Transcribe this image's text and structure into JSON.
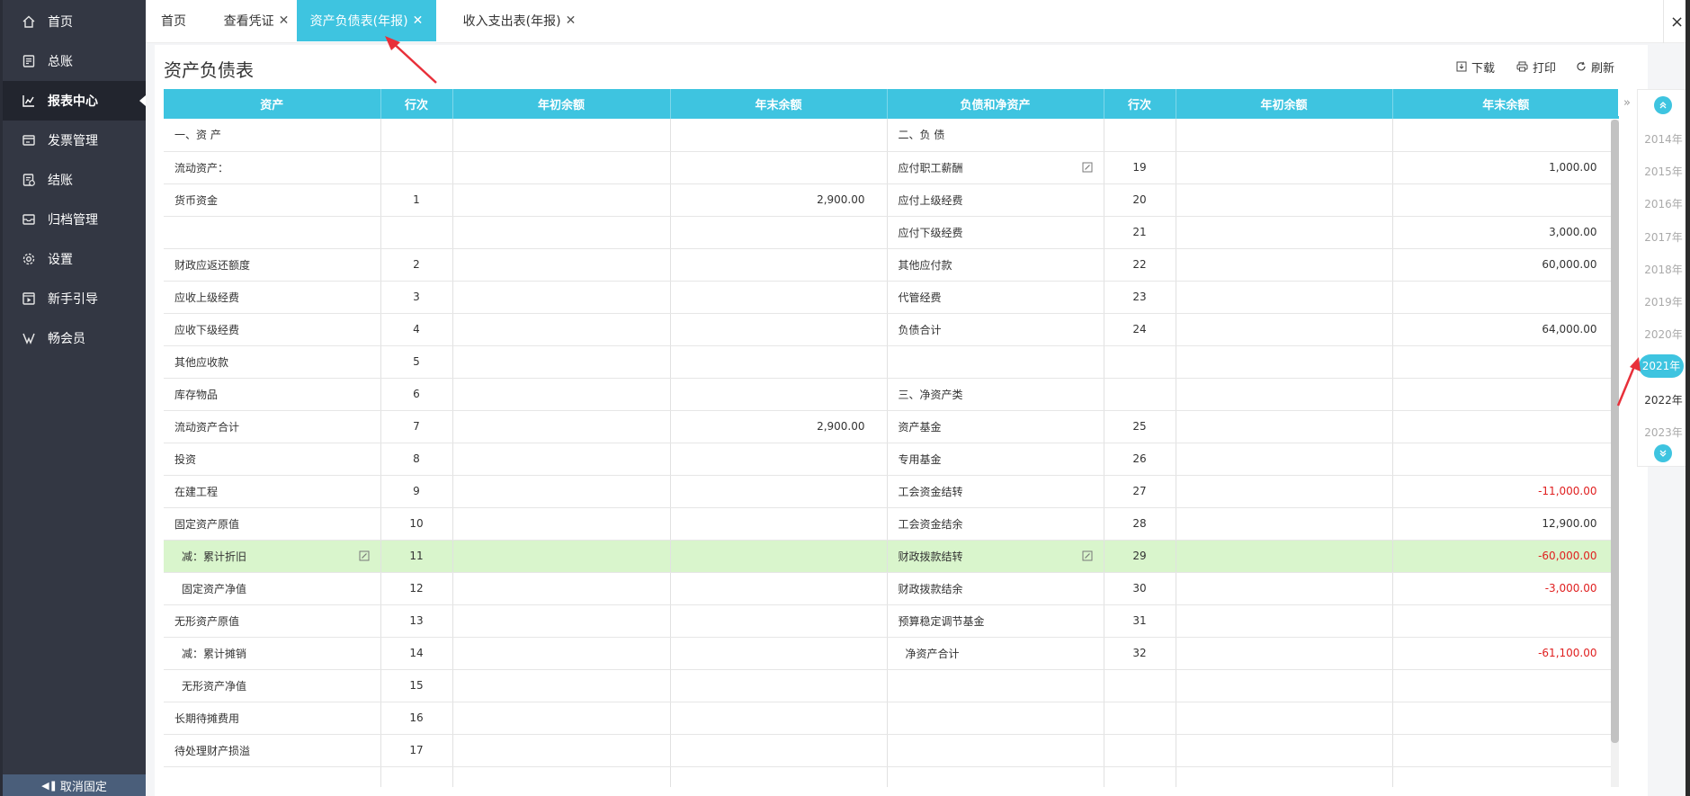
{
  "sidebar": {
    "items": [
      {
        "label": "首页",
        "icon": "home-icon"
      },
      {
        "label": "总账",
        "icon": "ledger-icon"
      },
      {
        "label": "报表中心",
        "icon": "chart-icon",
        "active": true
      },
      {
        "label": "发票管理",
        "icon": "invoice-icon"
      },
      {
        "label": "结账",
        "icon": "checkout-icon"
      },
      {
        "label": "归档管理",
        "icon": "archive-icon"
      },
      {
        "label": "设置",
        "icon": "gear-icon"
      },
      {
        "label": "新手引导",
        "icon": "guide-icon"
      },
      {
        "label": "畅会员",
        "icon": "vip-icon"
      }
    ],
    "unpin_label": "取消固定"
  },
  "tabs": [
    {
      "label": "首页",
      "closable": false
    },
    {
      "label": "查看凭证",
      "closable": true
    },
    {
      "label": "资产负债表(年报)",
      "closable": true,
      "active": true
    },
    {
      "label": "收入支出表(年报)",
      "closable": true
    }
  ],
  "window_close": "×",
  "page": {
    "title": "资产负债表",
    "toolbar": {
      "download": "下载",
      "print": "打印",
      "refresh": "刷新"
    }
  },
  "table": {
    "headers": [
      "资产",
      "行次",
      "年初余额",
      "年末余额",
      "负债和净资产",
      "行次",
      "年初余额",
      "年末余额"
    ],
    "rows": [
      {
        "a": "一、资 产",
        "al": "",
        "ab": "",
        "ae": "",
        "l": "二、负 债",
        "ll": "",
        "lb": "",
        "le": ""
      },
      {
        "a": "流动资产：",
        "al": "",
        "ab": "",
        "ae": "",
        "l": "应付职工薪酬",
        "ll": "19",
        "lb": "",
        "le": "1,000.00",
        "l_edit": true
      },
      {
        "a": "货币资金",
        "al": "1",
        "ab": "",
        "ae": "2,900.00",
        "l": "应付上级经费",
        "ll": "20",
        "lb": "",
        "le": ""
      },
      {
        "a": "",
        "al": "",
        "ab": "",
        "ae": "",
        "l": "应付下级经费",
        "ll": "21",
        "lb": "",
        "le": "3,000.00"
      },
      {
        "a": "财政应返还额度",
        "al": "2",
        "ab": "",
        "ae": "",
        "l": "其他应付款",
        "ll": "22",
        "lb": "",
        "le": "60,000.00"
      },
      {
        "a": "应收上级经费",
        "al": "3",
        "ab": "",
        "ae": "",
        "l": "代管经费",
        "ll": "23",
        "lb": "",
        "le": ""
      },
      {
        "a": "应收下级经费",
        "al": "4",
        "ab": "",
        "ae": "",
        "l": "负债合计",
        "ll": "24",
        "lb": "",
        "le": "64,000.00"
      },
      {
        "a": "其他应收款",
        "al": "5",
        "ab": "",
        "ae": "",
        "l": "",
        "ll": "",
        "lb": "",
        "le": ""
      },
      {
        "a": "库存物品",
        "al": "6",
        "ab": "",
        "ae": "",
        "l": "三、净资产类",
        "ll": "",
        "lb": "",
        "le": ""
      },
      {
        "a": "流动资产合计",
        "al": "7",
        "ab": "",
        "ae": "2,900.00",
        "l": "资产基金",
        "ll": "25",
        "lb": "",
        "le": ""
      },
      {
        "a": "投资",
        "al": "8",
        "ab": "",
        "ae": "",
        "l": "专用基金",
        "ll": "26",
        "lb": "",
        "le": ""
      },
      {
        "a": "在建工程",
        "al": "9",
        "ab": "",
        "ae": "",
        "l": "工会资金结转",
        "ll": "27",
        "lb": "",
        "le": "-11,000.00",
        "le_neg": true
      },
      {
        "a": "固定资产原值",
        "al": "10",
        "ab": "",
        "ae": "",
        "l": "工会资金结余",
        "ll": "28",
        "lb": "",
        "le": "12,900.00"
      },
      {
        "a": "减：累计折旧",
        "al": "11",
        "ab": "",
        "ae": "",
        "l": "财政拨款结转",
        "ll": "29",
        "lb": "",
        "le": "-60,000.00",
        "le_neg": true,
        "highlight": true,
        "a_edit": true,
        "l_edit": true,
        "a_indent": true
      },
      {
        "a": "固定资产净值",
        "al": "12",
        "ab": "",
        "ae": "",
        "l": "财政拨款结余",
        "ll": "30",
        "lb": "",
        "le": "-3,000.00",
        "le_neg": true,
        "a_indent": true
      },
      {
        "a": "无形资产原值",
        "al": "13",
        "ab": "",
        "ae": "",
        "l": "预算稳定调节基金",
        "ll": "31",
        "lb": "",
        "le": ""
      },
      {
        "a": "减：累计摊销",
        "al": "14",
        "ab": "",
        "ae": "",
        "l": "净资产合计",
        "ll": "32",
        "lb": "",
        "le": "-61,100.00",
        "le_neg": true,
        "a_indent": true,
        "l_indent": true
      },
      {
        "a": "无形资产净值",
        "al": "15",
        "ab": "",
        "ae": "",
        "l": "",
        "ll": "",
        "lb": "",
        "le": "",
        "a_indent": true
      },
      {
        "a": "长期待摊费用",
        "al": "16",
        "ab": "",
        "ae": "",
        "l": "",
        "ll": "",
        "lb": "",
        "le": ""
      },
      {
        "a": "待处理财产损溢",
        "al": "17",
        "ab": "",
        "ae": "",
        "l": "",
        "ll": "",
        "lb": "",
        "le": ""
      },
      {
        "a": "",
        "al": "",
        "ab": "",
        "ae": "",
        "l": "",
        "ll": "",
        "lb": "",
        "le": ""
      }
    ]
  },
  "years": {
    "items": [
      "2014年",
      "2015年",
      "2016年",
      "2017年",
      "2018年",
      "2019年",
      "2020年",
      "2021年",
      "2022年",
      "2023年"
    ],
    "active": "2021年",
    "current": "2022年"
  },
  "colors": {
    "accent": "#3ec4e0",
    "sidebar": "#333743",
    "highlight_row": "#d9f5cc",
    "negative": "#e02020",
    "annotation": "#e8303a"
  }
}
